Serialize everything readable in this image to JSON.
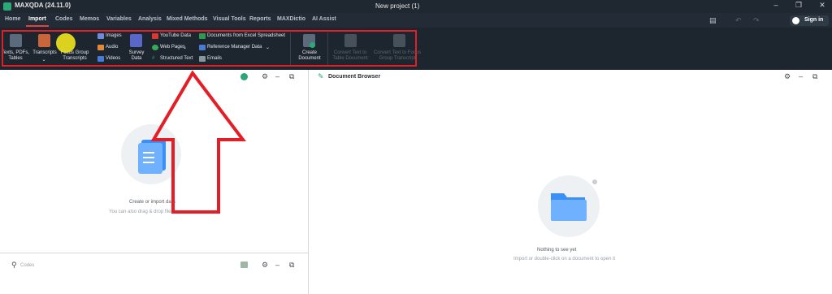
{
  "app": {
    "title": "MAXQDA (24.11.0)",
    "document_title": "New project (1)"
  },
  "menu": {
    "tabs": [
      "Home",
      "Import",
      "Codes",
      "Memos",
      "Variables",
      "Analysis",
      "Mixed Methods",
      "Visual Tools",
      "Reports",
      "MAXDictio",
      "AI Assist"
    ],
    "active_tab": "Import",
    "sign_in": "Sign in"
  },
  "ribbon": {
    "texts_pdfs_tables": "Texts, PDFs, Tables",
    "transcripts": "Transcripts",
    "focus_group": "Focus Group Transcripts",
    "images": "Images",
    "audio": "Audio",
    "videos": "Videos",
    "survey_data": "Survey Data",
    "youtube": "YouTube Data",
    "web_pages": "Web Pages",
    "structured_text": "Structured Text",
    "excel": "Documents from Excel Spreadsheet",
    "reference_manager": "Reference Manager Data",
    "emails": "Emails",
    "create_document": "Create Document",
    "convert_table": "Convert Text to Table Document",
    "convert_focus": "Convert Text to Focus Group Transcript"
  },
  "left_pane": {
    "empty_title": "Create or import data",
    "empty_sub": "You can also drag & drop files"
  },
  "codes_pane": {
    "search_placeholder": "Codes"
  },
  "document_browser": {
    "title": "Document Browser",
    "empty_title": "Nothing to see yet",
    "empty_sub": "Import or double-click on a document to open it"
  },
  "colors": {
    "highlight": "#e41e26",
    "arrow": "#e41e26",
    "cursor": "#f0e61e",
    "accent_green": "#2aa876"
  }
}
